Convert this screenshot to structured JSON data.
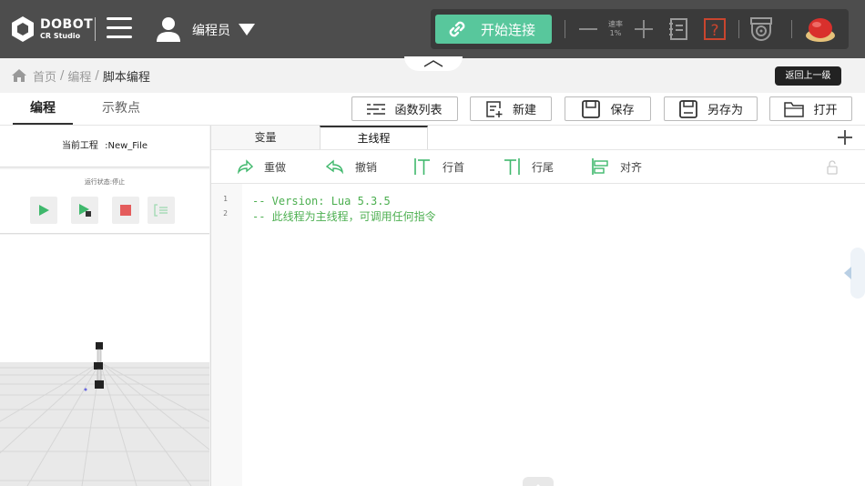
{
  "header": {
    "brand": "DOBOT",
    "product": "CR Studio",
    "user_name": "编程员",
    "connect_label": "开始连接",
    "speed_label": "速率",
    "speed_value": "1%"
  },
  "breadcrumb": {
    "home": "首页",
    "sep": "/",
    "programming": "编程",
    "current": "脚本编程"
  },
  "back_button": "返回上一级",
  "main_tabs": [
    "编程",
    "示教点"
  ],
  "toolbar": {
    "function_list": "函数列表",
    "new": "新建",
    "save": "保存",
    "save_as": "另存为",
    "open": "打开"
  },
  "project": {
    "label": "当前工程",
    "name": ":New_File"
  },
  "run_status": "运行状态:停止",
  "editor": {
    "tabs": [
      "变量",
      "主线程"
    ],
    "actions": {
      "redo": "重做",
      "undo": "撤销",
      "line_start": "行首",
      "line_end": "行尾",
      "align": "对齐"
    },
    "line_numbers": [
      "1",
      "2"
    ],
    "lines": [
      "-- Version: Lua 5.3.5",
      "-- 此线程为主线程，可调用任何指令"
    ]
  },
  "colors": {
    "topbar": "#4d4d4d",
    "accent_green": "#58c79c",
    "code_green": "#4caf50",
    "estop_red": "#d9302c"
  }
}
